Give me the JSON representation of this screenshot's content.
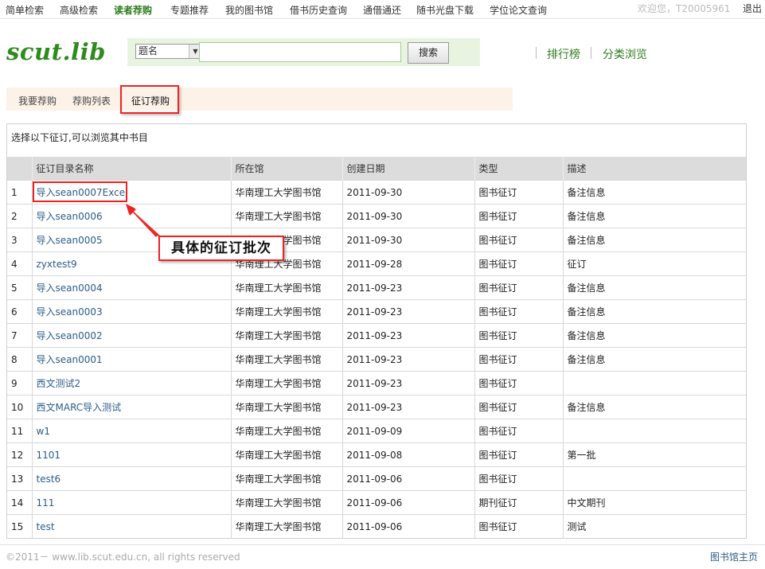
{
  "topnav": {
    "items": [
      {
        "label": "简单检索"
      },
      {
        "label": "高级检索"
      },
      {
        "label": "读者荐购"
      },
      {
        "label": "专题推荐"
      },
      {
        "label": "我的图书馆"
      },
      {
        "label": "借书历史查询"
      },
      {
        "label": "通借通还"
      },
      {
        "label": "随书光盘下载"
      },
      {
        "label": "学位论文查询"
      }
    ],
    "active_index": 2,
    "welcome": "欢迎您，T20005961",
    "logout": "退出"
  },
  "header": {
    "logo": "scut.lib",
    "search": {
      "field_selected": "题名",
      "query": "",
      "button": "搜索"
    },
    "links": [
      "排行榜",
      "分类浏览"
    ]
  },
  "tabs": {
    "items": [
      {
        "label": "我要荐购"
      },
      {
        "label": "荐购列表"
      },
      {
        "label": "征订荐购"
      }
    ],
    "selected_index": 2
  },
  "panel": {
    "intro": "选择以下征订,可以浏览其中书目",
    "columns": [
      "",
      "征订目录名称",
      "所在馆",
      "创建日期",
      "类型",
      "描述"
    ],
    "rows": [
      [
        "1",
        "导入sean0007Excel",
        "华南理工大学图书馆",
        "2011-09-30",
        "图书征订",
        "备注信息"
      ],
      [
        "2",
        "导入sean0006",
        "华南理工大学图书馆",
        "2011-09-30",
        "图书征订",
        "备注信息"
      ],
      [
        "3",
        "导入sean0005",
        "华南理工大学图书馆",
        "2011-09-30",
        "图书征订",
        "备注信息"
      ],
      [
        "4",
        "zyxtest9",
        "华南理工大学图书馆",
        "2011-09-28",
        "图书征订",
        "征订"
      ],
      [
        "5",
        "导入sean0004",
        "华南理工大学图书馆",
        "2011-09-23",
        "图书征订",
        "备注信息"
      ],
      [
        "6",
        "导入sean0003",
        "华南理工大学图书馆",
        "2011-09-23",
        "图书征订",
        "备注信息"
      ],
      [
        "7",
        "导入sean0002",
        "华南理工大学图书馆",
        "2011-09-23",
        "图书征订",
        "备注信息"
      ],
      [
        "8",
        "导入sean0001",
        "华南理工大学图书馆",
        "2011-09-23",
        "图书征订",
        "备注信息"
      ],
      [
        "9",
        "西文测试2",
        "华南理工大学图书馆",
        "2011-09-23",
        "图书征订",
        ""
      ],
      [
        "10",
        "西文MARC导入测试",
        "华南理工大学图书馆",
        "2011-09-23",
        "图书征订",
        "备注信息"
      ],
      [
        "11",
        "w1",
        "华南理工大学图书馆",
        "2011-09-09",
        "图书征订",
        ""
      ],
      [
        "12",
        "1101",
        "华南理工大学图书馆",
        "2011-09-08",
        "图书征订",
        "第一批"
      ],
      [
        "13",
        "test6",
        "华南理工大学图书馆",
        "2011-09-06",
        "图书征订",
        ""
      ],
      [
        "14",
        "111",
        "华南理工大学图书馆",
        "2011-09-06",
        "期刊征订",
        "中文期刊"
      ],
      [
        "15",
        "test",
        "华南理工大学图书馆",
        "2011-09-06",
        "图书征订",
        "测试"
      ]
    ]
  },
  "annotation": {
    "callout": "具体的征订批次"
  },
  "footer": {
    "copyright": "©2011－ www.lib.scut.edu.cn, all rights reserved",
    "home_link": "图书馆主页"
  },
  "colors": {
    "brand_green": "#2e8b1e",
    "link_blue": "#2b5c8a",
    "highlight_red": "#e22222",
    "tab_bar_bg": "#fdf2e8",
    "search_bar_bg": "#e8f4e0"
  }
}
